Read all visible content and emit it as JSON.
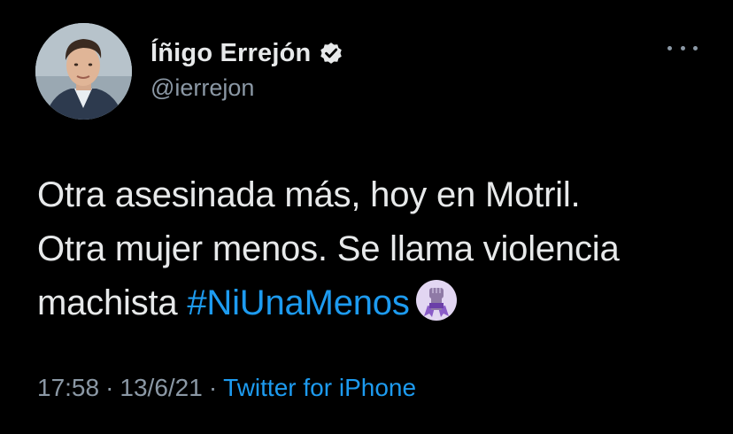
{
  "user": {
    "display_name": "Íñigo Errejón",
    "handle": "@ierrejon",
    "verified": true
  },
  "tweet": {
    "line1": "Otra asesinada más, hoy en Motril.",
    "line2": "Otra mujer menos. Se llama violencia",
    "line3_prefix": "machista ",
    "hashtag": "#NiUnaMenos",
    "emoji_icon": "raised-fist-purple-ribbon-icon"
  },
  "meta": {
    "time": "17:58",
    "date": "13/6/21",
    "separator": "·",
    "source": "Twitter for iPhone"
  },
  "colors": {
    "background": "#000000",
    "text": "#e7e9ea",
    "muted": "#8b98a5",
    "accent": "#1d9bf0",
    "emoji_circle": "#e2d6f2",
    "emoji_fist": "#8f7aa6"
  }
}
